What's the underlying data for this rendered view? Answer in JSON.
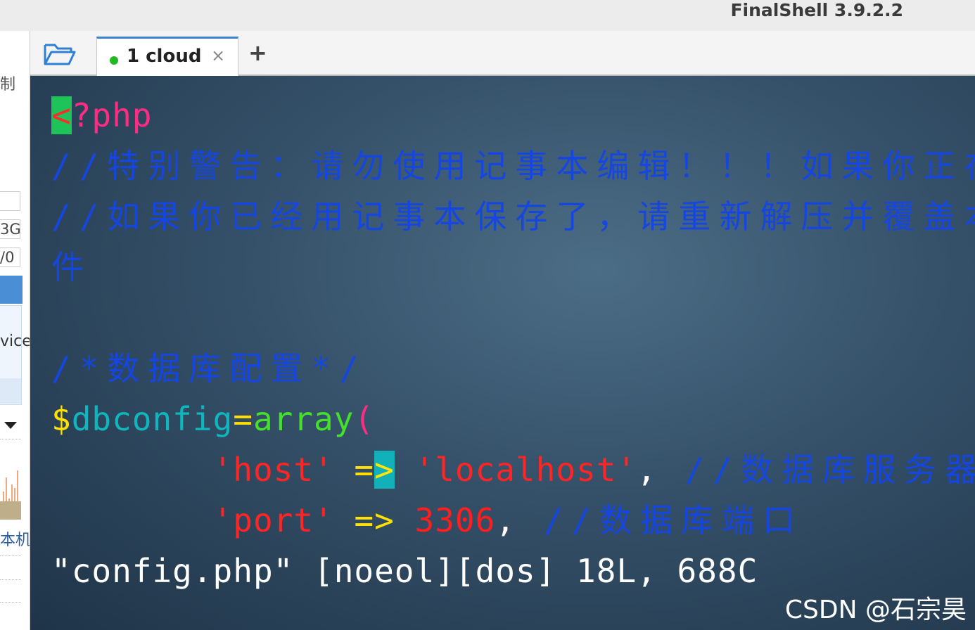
{
  "app": {
    "title": "FinalShell 3.9.2.2"
  },
  "left_panel": {
    "text_top": "制",
    "box1": "",
    "box2": "3G",
    "box3": "/0",
    "service": "vice",
    "machine": "本机"
  },
  "tabs": [
    {
      "index": "1",
      "label": "1 cloud",
      "status": "connected"
    }
  ],
  "tab_close": "×",
  "add_tab": "+",
  "terminal": {
    "l1_cursor": "<",
    "l1_rest": "?php",
    "l2": "//特别警告：请勿使用记事本编辑！！！如果你正在使",
    "l3": "//如果你已经用记事本保存了，请重新解压并覆盖本文",
    "l4": "件",
    "l5": "",
    "l6": "/*数据库配置*/",
    "l7_dollar": "$",
    "l7_name": "dbconfig",
    "l7_eq": "=",
    "l7_array": "array",
    "l7_paren": "(",
    "l8_indent": "        ",
    "l8_key": "'host'",
    "l8_arrow_a": " =",
    "l8_arrow_b": ">",
    "l8_val": " 'localhost'",
    "l8_comma": ",",
    "l8_comment": " //数据库服务器",
    "l9_indent": "        ",
    "l9_key": "'port'",
    "l9_arrow": " =>",
    "l9_val": " 3306",
    "l9_comma": ",",
    "l9_comment": " //数据库端口",
    "status_line": "\"config.php\" [noeol][dos] 18L, 688C"
  },
  "watermark": "CSDN @石宗昊",
  "colors": {
    "php_tag": "#ff2c84",
    "comment": "#1546e0",
    "string": "#ff2525",
    "number": "#ff1e1e",
    "cursor": "#1ec45a"
  }
}
